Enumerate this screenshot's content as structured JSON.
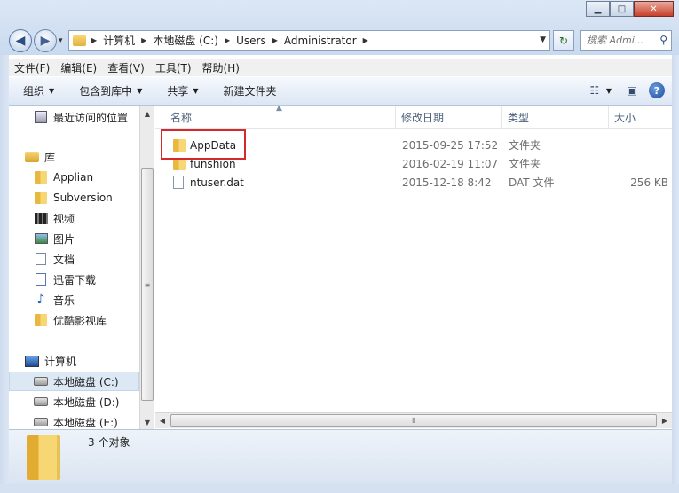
{
  "window": {
    "controls": {
      "minimize": "▁",
      "maximize": "□",
      "close": "✕"
    }
  },
  "navigation": {
    "back_icon": "arrow-left-icon",
    "forward_icon": "arrow-right-icon",
    "back_glyph": "◀",
    "forward_glyph": "▶",
    "recent_glyph": "▾"
  },
  "address": {
    "crumbs": [
      "计算机",
      "本地磁盘 (C:)",
      "Users",
      "Administrator"
    ],
    "separator": "▶",
    "dropdown_glyph": "▼",
    "refresh_glyph": "↻"
  },
  "search": {
    "placeholder": "搜索 Admi...",
    "icon_glyph": "⚲"
  },
  "menu": {
    "items": [
      "文件(F)",
      "编辑(E)",
      "查看(V)",
      "工具(T)",
      "帮助(H)"
    ]
  },
  "toolbar": {
    "organize": "组织",
    "include_in_library": "包含到库中",
    "share": "共享",
    "new_folder": "新建文件夹",
    "dropdown_glyph": "▼",
    "view_glyph": "☷",
    "preview_glyph": "▣",
    "help_glyph": "?"
  },
  "sidebar": {
    "items": [
      {
        "label": "最近访问的位置",
        "icon": "recent-places-icon"
      },
      {
        "label": "库",
        "icon": "library-icon"
      },
      {
        "label": "Applian",
        "icon": "folder-icon"
      },
      {
        "label": "Subversion",
        "icon": "folder-icon"
      },
      {
        "label": "视频",
        "icon": "video-icon"
      },
      {
        "label": "图片",
        "icon": "pictures-icon"
      },
      {
        "label": "文档",
        "icon": "documents-icon"
      },
      {
        "label": "迅雷下载",
        "icon": "download-icon"
      },
      {
        "label": "音乐",
        "icon": "music-icon"
      },
      {
        "label": "优酷影视库",
        "icon": "folder-icon"
      },
      {
        "label": "计算机",
        "icon": "computer-icon"
      },
      {
        "label": "本地磁盘 (C:)",
        "icon": "drive-icon",
        "selected": true
      },
      {
        "label": "本地磁盘 (D:)",
        "icon": "drive-icon"
      },
      {
        "label": "本地磁盘 (E:)",
        "icon": "drive-icon"
      }
    ],
    "music_glyph": "♪"
  },
  "file_list": {
    "columns": [
      "名称",
      "修改日期",
      "类型",
      "大小"
    ],
    "sort_glyph": "▲",
    "rows": [
      {
        "name": "AppData",
        "modified": "2015-09-25 17:52",
        "type": "文件夹",
        "size": "",
        "icon": "folder-icon",
        "highlighted": true
      },
      {
        "name": "funshion",
        "modified": "2016-02-19 11:07",
        "type": "文件夹",
        "size": "",
        "icon": "folder-icon"
      },
      {
        "name": "ntuser.dat",
        "modified": "2015-12-18 8:42",
        "type": "DAT 文件",
        "size": "256 KB",
        "icon": "file-icon"
      }
    ]
  },
  "scrollbars": {
    "up": "▲",
    "down": "▼",
    "left": "◀",
    "right": "▶",
    "grip_v": "≡",
    "grip_h": "⦀"
  },
  "status": {
    "count_text": "3 个对象"
  },
  "colors": {
    "highlight_border": "#d62a2a",
    "selection": "#dde8f5",
    "chrome": "#dbe7f5"
  }
}
